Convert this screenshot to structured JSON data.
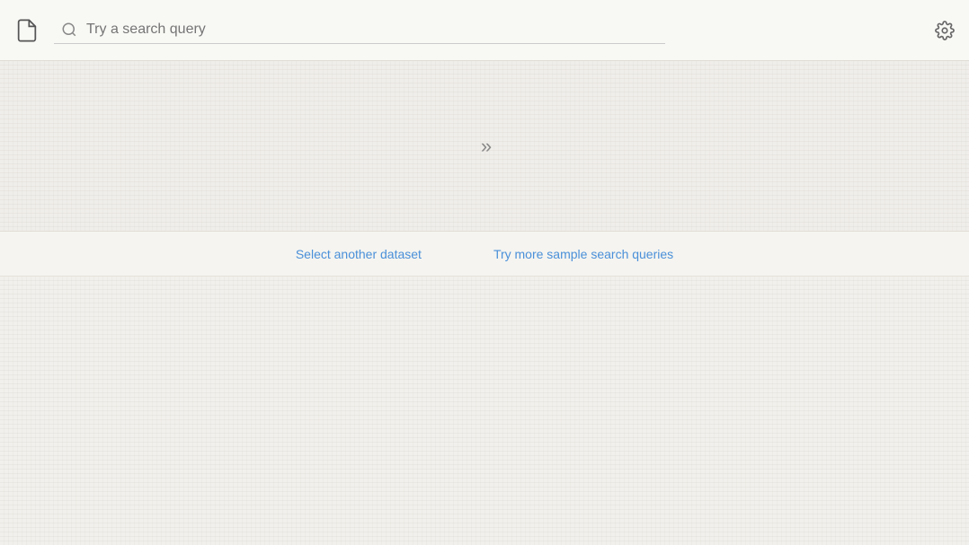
{
  "header": {
    "search_placeholder": "Try a search query",
    "doc_icon": "document-icon",
    "gear_icon": "settings-icon"
  },
  "main": {
    "chevron_symbol": "»",
    "links": [
      {
        "id": "select-dataset",
        "label": "Select another dataset"
      },
      {
        "id": "sample-queries",
        "label": "Try more sample search queries"
      }
    ]
  }
}
